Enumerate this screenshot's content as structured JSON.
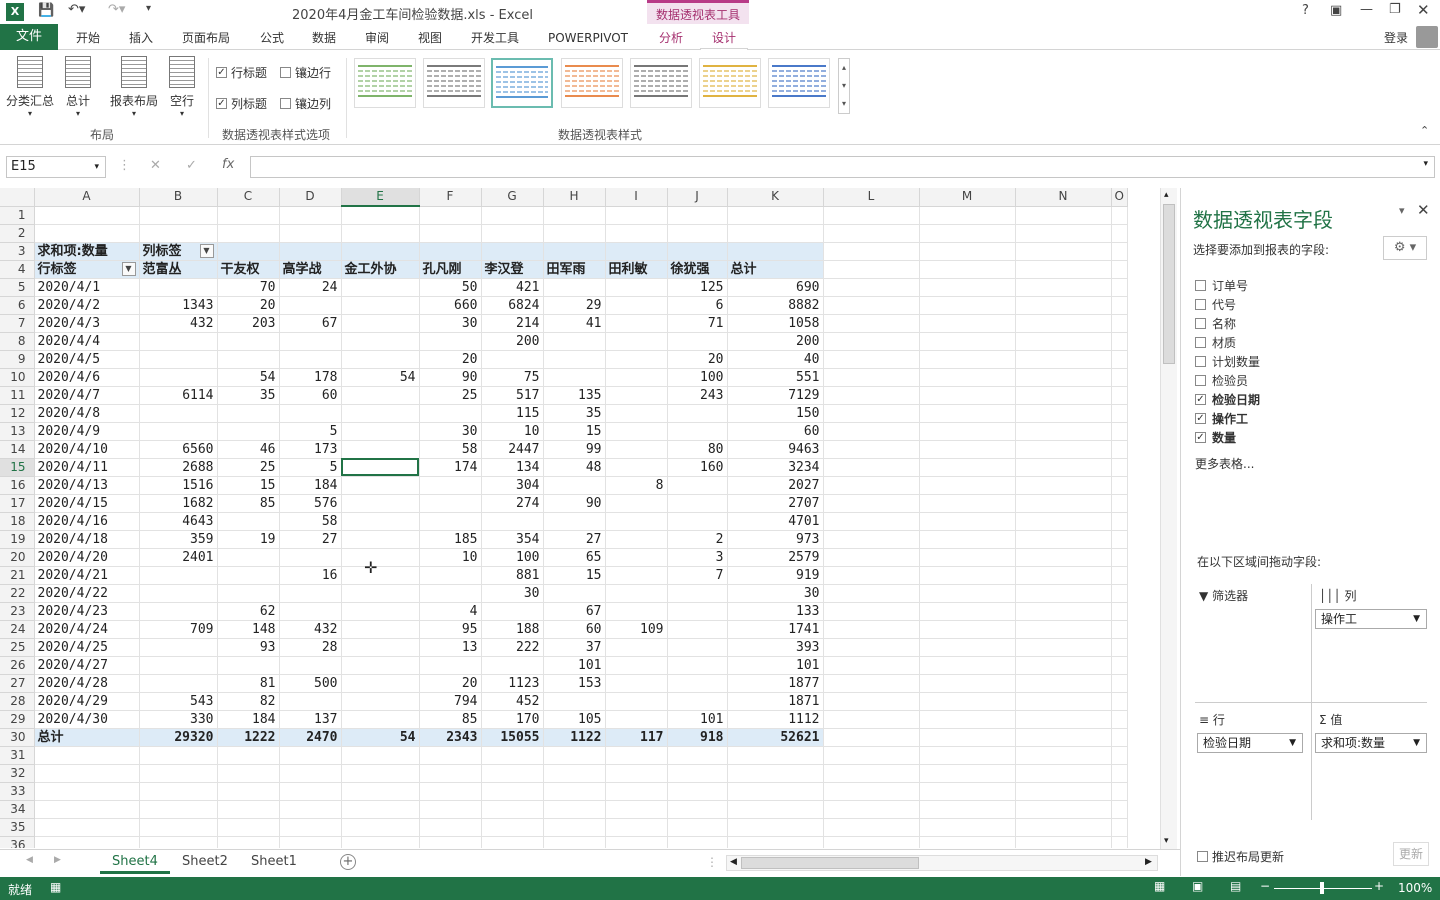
{
  "titlebar": {
    "title": "2020年4月金工车间检验数据.xls - Excel",
    "context_tools": "数据透视表工具",
    "help": "?",
    "login": "登录"
  },
  "tabs": [
    "开始",
    "插入",
    "页面布局",
    "公式",
    "数据",
    "审阅",
    "视图",
    "开发工具",
    "POWERPIVOT"
  ],
  "file_tab": "文件",
  "context_tabs": {
    "analyze": "分析",
    "design": "设计"
  },
  "ribbon": {
    "layout_buttons": [
      "分类汇总",
      "总计",
      "报表布局",
      "空行"
    ],
    "group_layout": "布局",
    "options": {
      "row_headers": "行标题",
      "col_headers": "列标题",
      "banded_rows": "镶边行",
      "banded_cols": "镶边列",
      "row_headers_checked": true,
      "col_headers_checked": true,
      "banded_rows_checked": false,
      "banded_cols_checked": false
    },
    "group_options": "数据透视表样式选项",
    "group_styles": "数据透视表样式",
    "style_colors": [
      "#7fb46b",
      "#7a7a7a",
      "#5b9bd5",
      "#e98b4e",
      "#777777",
      "#e0b341",
      "#4a79c9"
    ]
  },
  "formula_bar": {
    "namebox": "E15",
    "fx": "fx",
    "value": ""
  },
  "columns": [
    "A",
    "B",
    "C",
    "D",
    "E",
    "F",
    "G",
    "H",
    "I",
    "J",
    "K",
    "L",
    "M",
    "N",
    "O"
  ],
  "pivot": {
    "corner": "求和项:数量",
    "col_label": "列标签",
    "row_label": "行标签",
    "headers": [
      "范富丛",
      "干友权",
      "高学战",
      "金工外协",
      "孔凡刚",
      "李汉登",
      "田军雨",
      "田利敏",
      "徐犹强",
      "总计"
    ],
    "rows": [
      [
        "2020/4/1",
        "",
        "70",
        "24",
        "",
        "50",
        "421",
        "",
        "",
        "125",
        "690"
      ],
      [
        "2020/4/2",
        "1343",
        "20",
        "",
        "",
        "660",
        "6824",
        "29",
        "",
        "6",
        "8882"
      ],
      [
        "2020/4/3",
        "432",
        "203",
        "67",
        "",
        "30",
        "214",
        "41",
        "",
        "71",
        "1058"
      ],
      [
        "2020/4/4",
        "",
        "",
        "",
        "",
        "",
        "200",
        "",
        "",
        "",
        "200"
      ],
      [
        "2020/4/5",
        "",
        "",
        "",
        "",
        "20",
        "",
        "",
        "",
        "20",
        "40"
      ],
      [
        "2020/4/6",
        "",
        "54",
        "178",
        "54",
        "90",
        "75",
        "",
        "",
        "100",
        "551"
      ],
      [
        "2020/4/7",
        "6114",
        "35",
        "60",
        "",
        "25",
        "517",
        "135",
        "",
        "243",
        "7129"
      ],
      [
        "2020/4/8",
        "",
        "",
        "",
        "",
        "",
        "115",
        "35",
        "",
        "",
        "150"
      ],
      [
        "2020/4/9",
        "",
        "",
        "5",
        "",
        "30",
        "10",
        "15",
        "",
        "",
        "60"
      ],
      [
        "2020/4/10",
        "6560",
        "46",
        "173",
        "",
        "58",
        "2447",
        "99",
        "",
        "80",
        "9463"
      ],
      [
        "2020/4/11",
        "2688",
        "25",
        "5",
        "",
        "174",
        "134",
        "48",
        "",
        "160",
        "3234"
      ],
      [
        "2020/4/13",
        "1516",
        "15",
        "184",
        "",
        "",
        "304",
        "",
        "8",
        "",
        "2027"
      ],
      [
        "2020/4/15",
        "1682",
        "85",
        "576",
        "",
        "",
        "274",
        "90",
        "",
        "",
        "2707"
      ],
      [
        "2020/4/16",
        "4643",
        "",
        "58",
        "",
        "",
        "",
        "",
        "",
        "",
        "4701"
      ],
      [
        "2020/4/18",
        "359",
        "19",
        "27",
        "",
        "185",
        "354",
        "27",
        "",
        "2",
        "973"
      ],
      [
        "2020/4/20",
        "2401",
        "",
        "",
        "",
        "10",
        "100",
        "65",
        "",
        "3",
        "2579"
      ],
      [
        "2020/4/21",
        "",
        "",
        "16",
        "",
        "",
        "881",
        "15",
        "",
        "7",
        "919"
      ],
      [
        "2020/4/22",
        "",
        "",
        "",
        "",
        "",
        "30",
        "",
        "",
        "",
        "30"
      ],
      [
        "2020/4/23",
        "",
        "62",
        "",
        "",
        "4",
        "",
        "67",
        "",
        "",
        "133"
      ],
      [
        "2020/4/24",
        "709",
        "148",
        "432",
        "",
        "95",
        "188",
        "60",
        "109",
        "",
        "1741"
      ],
      [
        "2020/4/25",
        "",
        "93",
        "28",
        "",
        "13",
        "222",
        "37",
        "",
        "",
        "393"
      ],
      [
        "2020/4/27",
        "",
        "",
        "",
        "",
        "",
        "",
        "101",
        "",
        "",
        "101"
      ],
      [
        "2020/4/28",
        "",
        "81",
        "500",
        "",
        "20",
        "1123",
        "153",
        "",
        "",
        "1877"
      ],
      [
        "2020/4/29",
        "543",
        "82",
        "",
        "",
        "794",
        "452",
        "",
        "",
        "",
        "1871"
      ],
      [
        "2020/4/30",
        "330",
        "184",
        "137",
        "",
        "85",
        "170",
        "105",
        "",
        "101",
        "1112"
      ]
    ],
    "total": [
      "总计",
      "29320",
      "1222",
      "2470",
      "54",
      "2343",
      "15055",
      "1122",
      "117",
      "918",
      "52621"
    ]
  },
  "panel": {
    "title": "数据透视表字段",
    "subtitle": "选择要添加到报表的字段:",
    "fields": [
      {
        "name": "订单号",
        "checked": false
      },
      {
        "name": "代号",
        "checked": false
      },
      {
        "name": "名称",
        "checked": false
      },
      {
        "name": "材质",
        "checked": false
      },
      {
        "name": "计划数量",
        "checked": false
      },
      {
        "name": "检验员",
        "checked": false
      },
      {
        "name": "检验日期",
        "checked": true
      },
      {
        "name": "操作工",
        "checked": true
      },
      {
        "name": "数量",
        "checked": true
      }
    ],
    "more_tables": "更多表格...",
    "drag_hint": "在以下区域间拖动字段:",
    "zones": {
      "filter": "筛选器",
      "columns": "列",
      "rows": "行",
      "values": "值",
      "col_field": "操作工",
      "row_field": "检验日期",
      "val_field": "求和项:数量"
    },
    "defer": "推迟布局更新",
    "update": "更新"
  },
  "sheets": [
    "Sheet4",
    "Sheet2",
    "Sheet1"
  ],
  "status": {
    "ready": "就绪",
    "zoom": "100%"
  }
}
